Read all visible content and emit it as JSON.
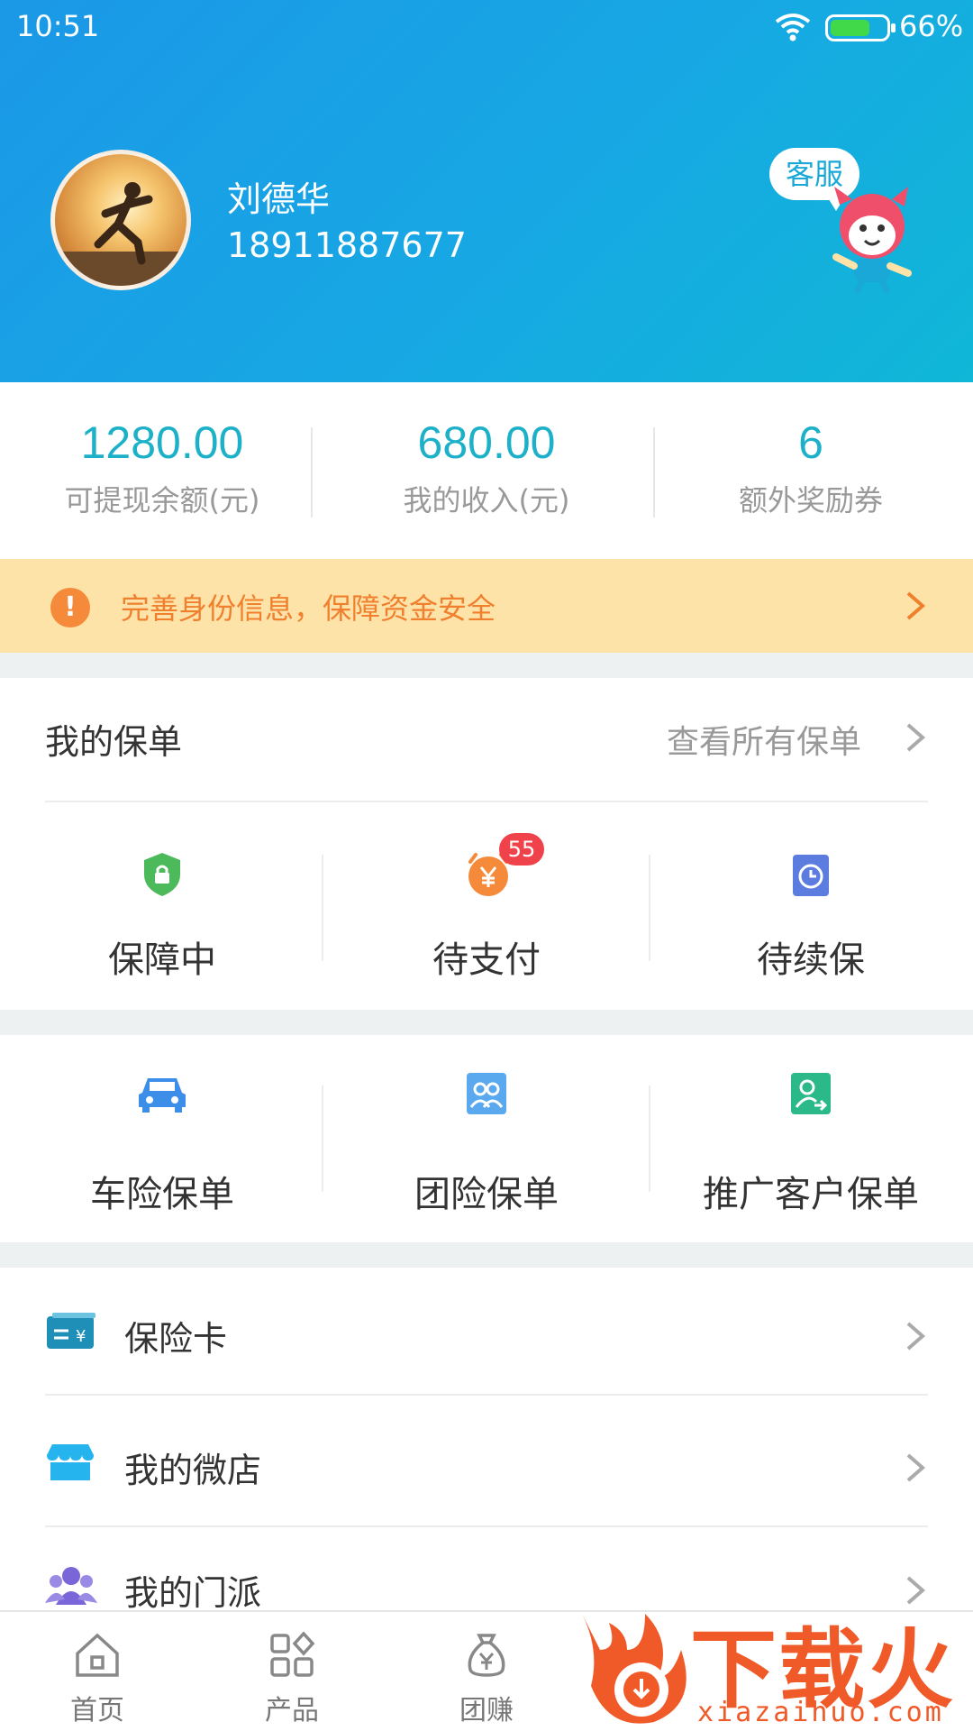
{
  "status_bar": {
    "time": "10:51",
    "battery": "66%"
  },
  "profile": {
    "name": "刘德华",
    "phone": "18911887677",
    "service_label": "客服"
  },
  "stats": [
    {
      "value": "1280.00",
      "label": "可提现余额(元)"
    },
    {
      "value": "680.00",
      "label": "我的收入(元)"
    },
    {
      "value": "6",
      "label": "额外奖励券"
    }
  ],
  "notice": {
    "text": "完善身份信息，保障资金安全"
  },
  "policies": {
    "title": "我的保单",
    "view_all": "查看所有保单",
    "items": [
      {
        "label": "保障中",
        "icon": "shield-lock-icon"
      },
      {
        "label": "待支付",
        "icon": "yuan-alarm-icon",
        "badge": "55"
      },
      {
        "label": "待续保",
        "icon": "clock-doc-icon"
      }
    ]
  },
  "policy_types": [
    {
      "label": "车险保单",
      "icon": "car-icon"
    },
    {
      "label": "团险保单",
      "icon": "group-icon"
    },
    {
      "label": "推广客户保单",
      "icon": "share-user-icon"
    }
  ],
  "menu": [
    {
      "label": "保险卡",
      "icon": "card-icon"
    },
    {
      "label": "我的微店",
      "icon": "shop-icon"
    },
    {
      "label": "我的门派",
      "icon": "people-icon"
    }
  ],
  "tabbar": [
    {
      "label": "首页",
      "icon": "home-icon"
    },
    {
      "label": "产品",
      "icon": "grid-icon"
    },
    {
      "label": "团赚",
      "icon": "money-bag-icon"
    }
  ],
  "watermark": {
    "text": "下载火",
    "sub": "xiazaihuo.com"
  },
  "colors": {
    "header": "#1b98e6",
    "accent": "#1cb1c9",
    "notice_bg": "#fde3a8",
    "notice_text": "#f07f2e"
  }
}
